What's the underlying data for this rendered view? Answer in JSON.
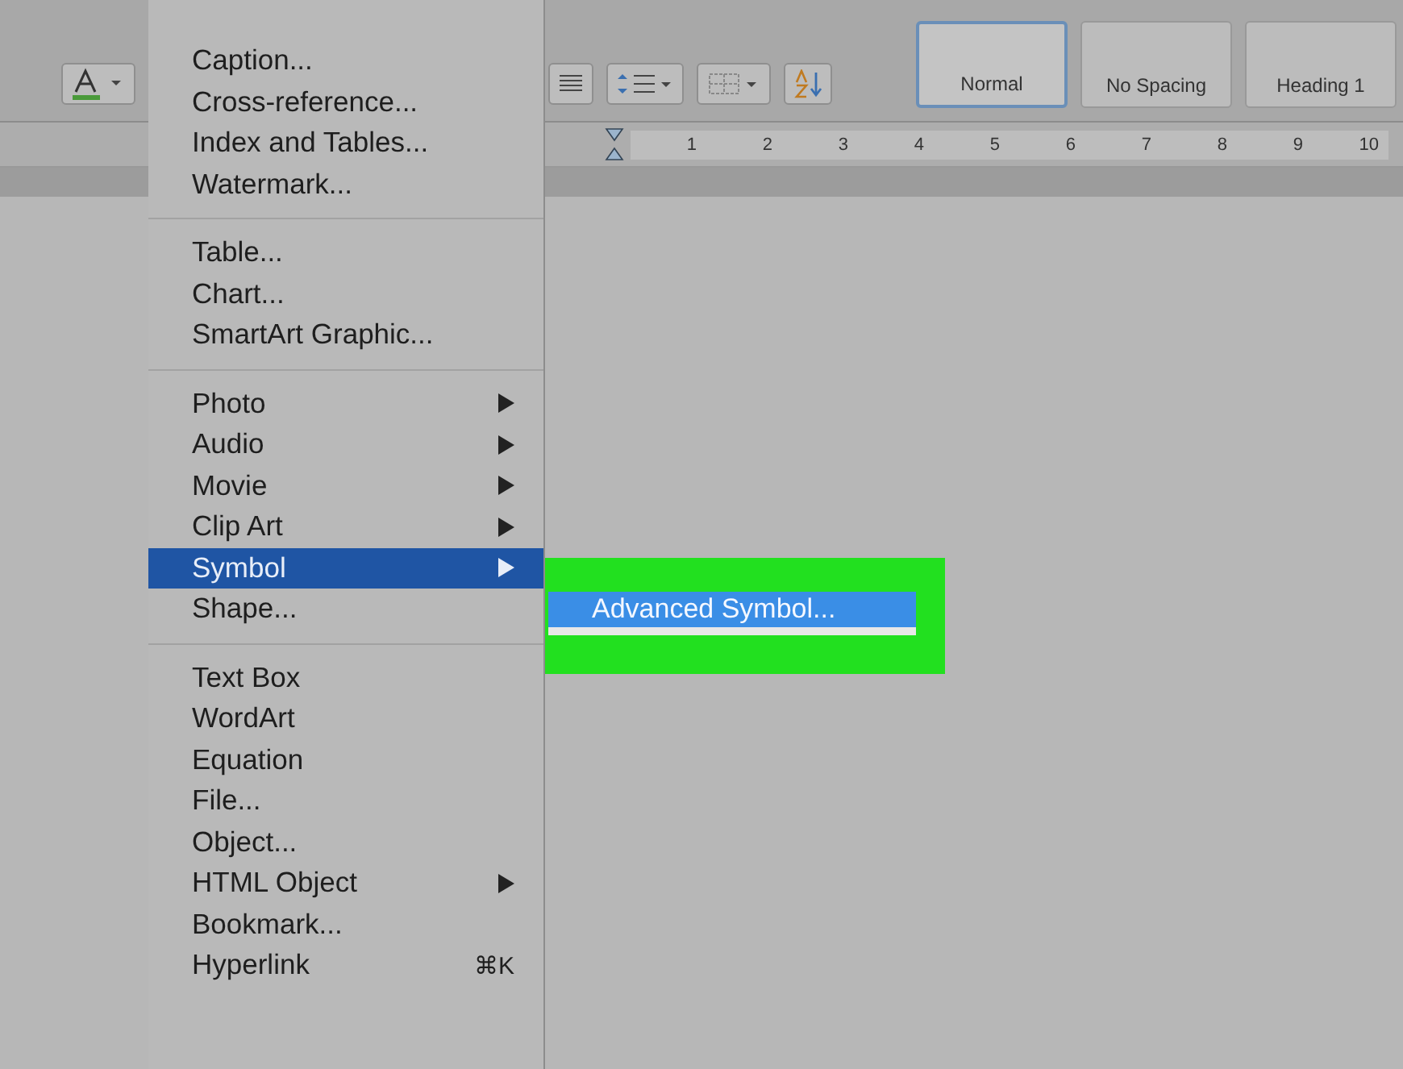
{
  "toolbar": {
    "styles": [
      {
        "name": "Normal",
        "selected": true
      },
      {
        "name": "No Spacing",
        "selected": false
      },
      {
        "name": "Heading 1",
        "selected": false
      }
    ]
  },
  "ruler": {
    "labels": [
      "1",
      "2",
      "3",
      "4",
      "5",
      "6",
      "7",
      "8",
      "9",
      "10"
    ]
  },
  "menu": {
    "groups": [
      [
        {
          "label": "Caption...",
          "submenu": false,
          "selected": false
        },
        {
          "label": "Cross-reference...",
          "submenu": false,
          "selected": false
        },
        {
          "label": "Index and Tables...",
          "submenu": false,
          "selected": false
        },
        {
          "label": "Watermark...",
          "submenu": false,
          "selected": false
        }
      ],
      [
        {
          "label": "Table...",
          "submenu": false,
          "selected": false
        },
        {
          "label": "Chart...",
          "submenu": false,
          "selected": false
        },
        {
          "label": "SmartArt Graphic...",
          "submenu": false,
          "selected": false
        }
      ],
      [
        {
          "label": "Photo",
          "submenu": true,
          "selected": false
        },
        {
          "label": "Audio",
          "submenu": true,
          "selected": false
        },
        {
          "label": "Movie",
          "submenu": true,
          "selected": false
        },
        {
          "label": "Clip Art",
          "submenu": true,
          "selected": false
        },
        {
          "label": "Symbol",
          "submenu": true,
          "selected": true
        },
        {
          "label": "Shape...",
          "submenu": false,
          "selected": false
        }
      ],
      [
        {
          "label": "Text Box",
          "submenu": false,
          "selected": false
        },
        {
          "label": "WordArt",
          "submenu": false,
          "selected": false
        },
        {
          "label": "Equation",
          "submenu": false,
          "selected": false
        },
        {
          "label": "File...",
          "submenu": false,
          "selected": false
        },
        {
          "label": "Object...",
          "submenu": false,
          "selected": false
        },
        {
          "label": "HTML Object",
          "submenu": true,
          "selected": false
        },
        {
          "label": "Bookmark...",
          "submenu": false,
          "selected": false
        },
        {
          "label": "Hyperlink",
          "submenu": false,
          "selected": false,
          "shortcut": "⌘K"
        }
      ]
    ]
  },
  "submenu": {
    "items": [
      {
        "label": "Advanced Symbol...",
        "selected": true
      }
    ]
  }
}
